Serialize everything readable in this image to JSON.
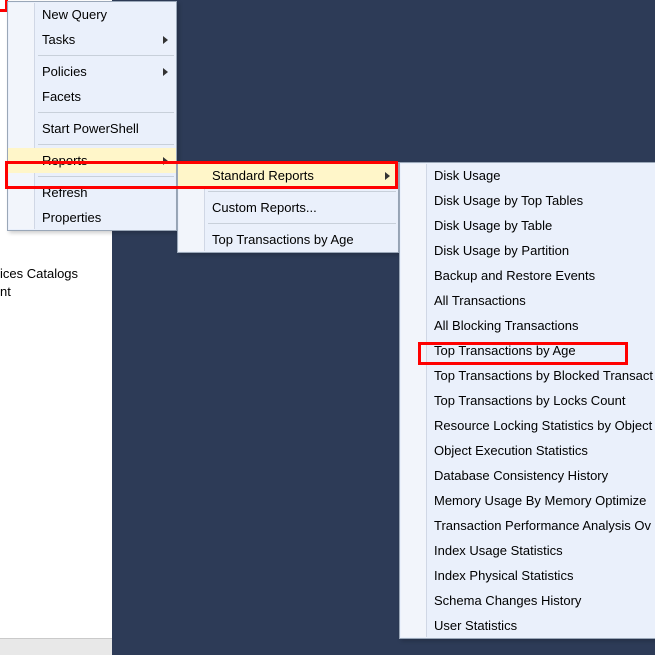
{
  "bg": {
    "line1": "ices Catalogs",
    "line2": "nt"
  },
  "menu1": {
    "new_query": "New Query",
    "tasks": "Tasks",
    "policies": "Policies",
    "facets": "Facets",
    "start_powershell": "Start PowerShell",
    "reports": "Reports",
    "refresh": "Refresh",
    "properties": "Properties"
  },
  "menu2": {
    "standard_reports": "Standard Reports",
    "custom_reports": "Custom Reports...",
    "top_transactions_by_age": "Top Transactions by Age"
  },
  "menu3": {
    "items": [
      "Disk Usage",
      "Disk Usage by Top Tables",
      "Disk Usage by Table",
      "Disk Usage by Partition",
      "Backup and Restore Events",
      "All Transactions",
      "All Blocking Transactions",
      "Top Transactions by Age",
      "Top Transactions by Blocked Transact",
      "Top Transactions by Locks Count",
      "Resource Locking Statistics by Object",
      "Object Execution Statistics",
      "Database Consistency History",
      "Memory Usage By Memory Optimize",
      "Transaction Performance Analysis Ov",
      "Index Usage Statistics",
      "Index Physical Statistics",
      "Schema Changes History",
      "User Statistics"
    ]
  }
}
